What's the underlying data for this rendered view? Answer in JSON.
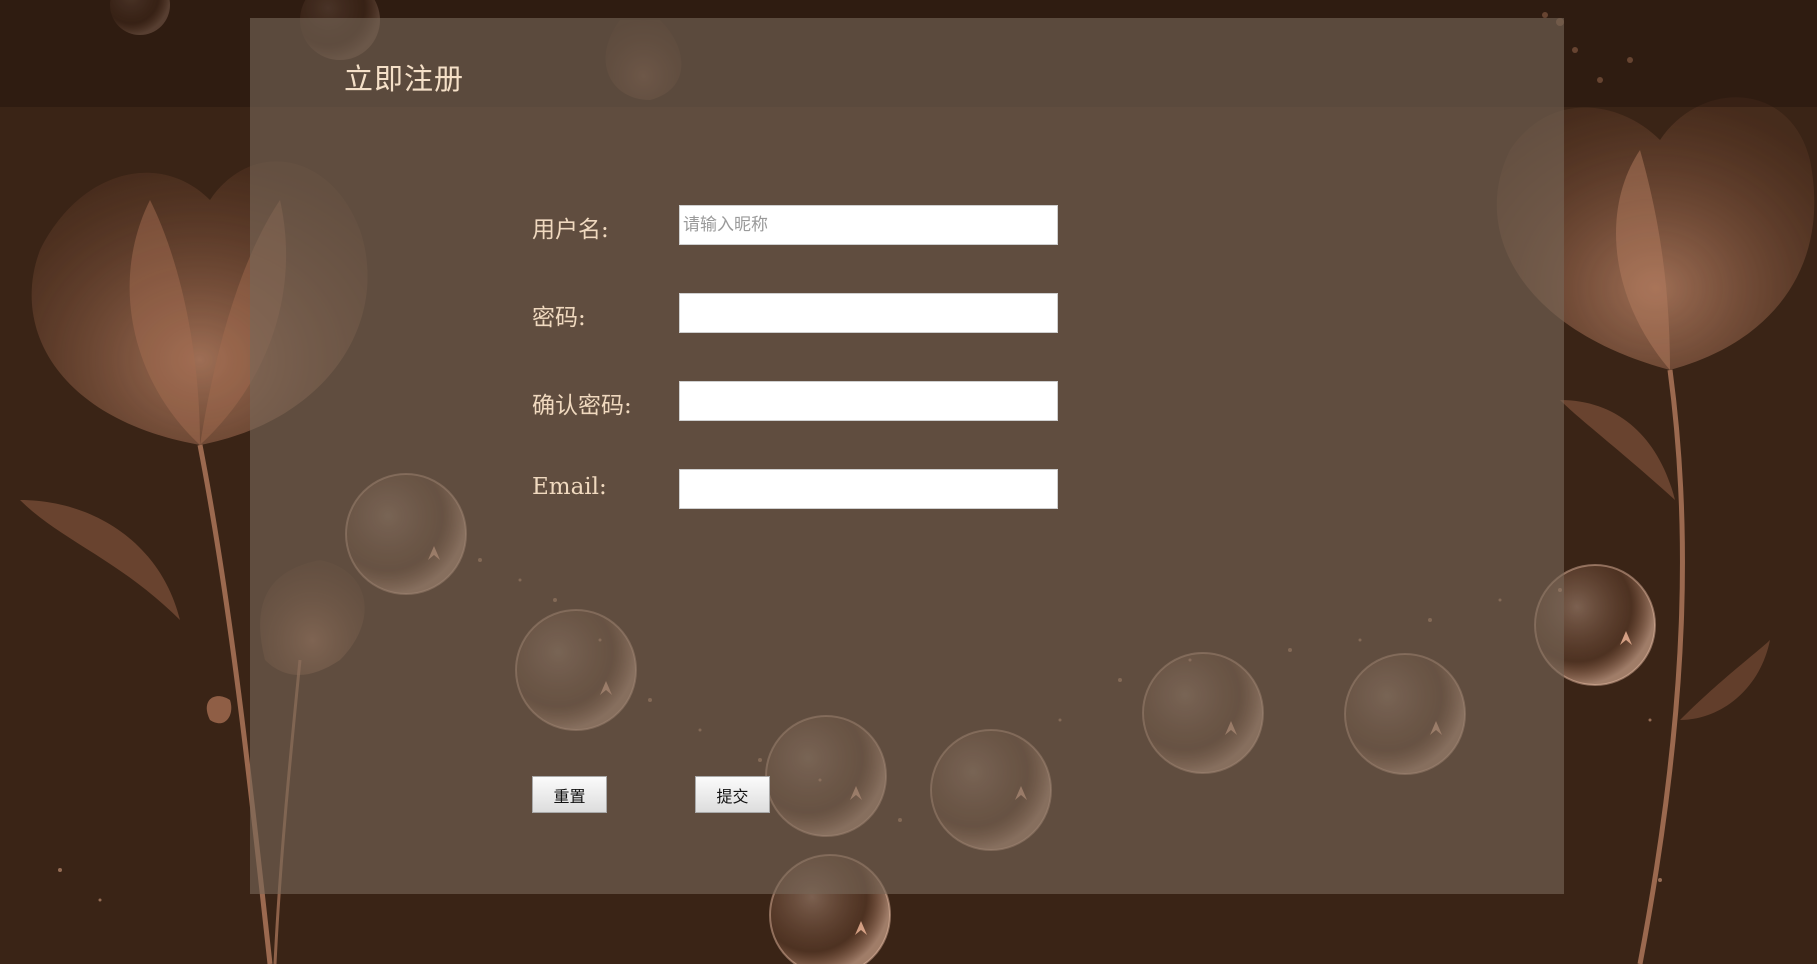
{
  "page": {
    "title": "立即注册"
  },
  "form": {
    "username": {
      "label": "用户名:",
      "placeholder": "请输入昵称",
      "value": ""
    },
    "password": {
      "label": "密码:",
      "value": ""
    },
    "confirm_password": {
      "label": "确认密码:",
      "value": ""
    },
    "email": {
      "label": "Email:",
      "value": ""
    }
  },
  "buttons": {
    "reset_label": "重置",
    "submit_label": "提交"
  },
  "colors": {
    "background": "#3a2416",
    "panel": "#6b5a4a",
    "label_text": "#f0d9bf",
    "flower_accent": "#c98b6c"
  }
}
